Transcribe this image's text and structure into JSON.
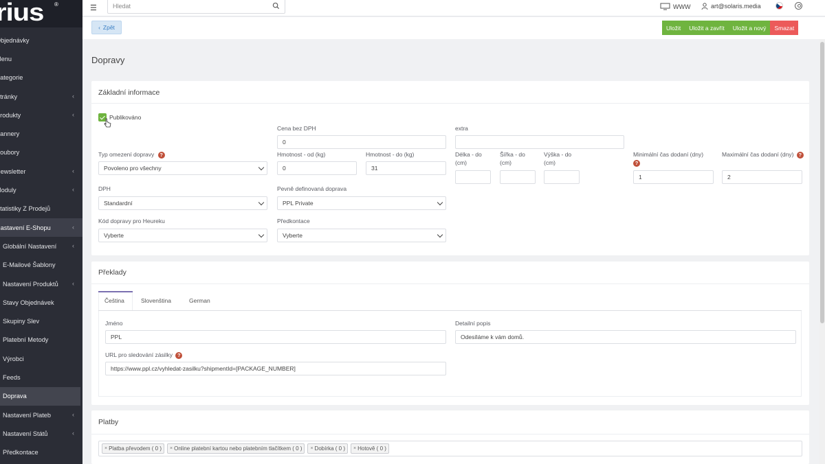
{
  "brand": {
    "logo_text": "rius",
    "reg": "®"
  },
  "sidebar": {
    "items": [
      {
        "label": "Objednávky",
        "chevron": false
      },
      {
        "label": "Menu",
        "chevron": false
      },
      {
        "label": "Kategorie",
        "chevron": false
      },
      {
        "label": "Stránky",
        "chevron": true
      },
      {
        "label": "Produkty",
        "chevron": true
      },
      {
        "label": "Bannery",
        "chevron": false
      },
      {
        "label": "Soubory",
        "chevron": false
      },
      {
        "label": "Newsletter",
        "chevron": true
      },
      {
        "label": "Moduly",
        "chevron": true
      },
      {
        "label": "Statistiky Z Prodejů",
        "chevron": false
      },
      {
        "label": "Nastavení E-Shopu",
        "chevron": true,
        "state": "open"
      },
      {
        "label": "Globální Nastavení",
        "chevron": true,
        "sub": true
      },
      {
        "label": "E-Mailové Šablony",
        "chevron": false,
        "sub": true
      },
      {
        "label": "Nastavení Produktů",
        "chevron": true,
        "sub": true
      },
      {
        "label": "Stavy Objednávek",
        "chevron": false,
        "sub": true
      },
      {
        "label": "Skupiny Slev",
        "chevron": false,
        "sub": true
      },
      {
        "label": "Platební Metody",
        "chevron": false,
        "sub": true
      },
      {
        "label": "Výrobci",
        "chevron": false,
        "sub": true
      },
      {
        "label": "Feeds",
        "chevron": false,
        "sub": true
      },
      {
        "label": "Doprava",
        "chevron": false,
        "sub": true,
        "state": "active"
      },
      {
        "label": "Nastavení Plateb",
        "chevron": true,
        "sub": true
      },
      {
        "label": "Nastavení Států",
        "chevron": true,
        "sub": true
      },
      {
        "label": "Předkontace",
        "chevron": false,
        "sub": true
      }
    ]
  },
  "topbar": {
    "search_placeholder": "Hledat",
    "www_label": "WWW",
    "user_email": "art@solaris.media"
  },
  "actions": {
    "back_label": "Zpět",
    "save_label": "Uložit",
    "save_close_label": "Uložit a zavřít",
    "save_new_label": "Uložit a nový",
    "delete_label": "Smazat"
  },
  "page": {
    "title": "Dopravy"
  },
  "basic": {
    "heading": "Základní informace",
    "published_label": "Publikováno",
    "published_checked": true,
    "price_label": "Cena bez DPH",
    "price_value": "0",
    "extra_label": "extra",
    "extra_value": "",
    "limit_type_label": "Typ omezení dopravy",
    "limit_type_value": "Povoleno pro všechny",
    "weight_from_label": "Hmotnost - od (kg)",
    "weight_from_value": "0",
    "weight_to_label": "Hmotnost - do (kg)",
    "weight_to_value": "31",
    "length_label": "Délka - do (cm)",
    "width_label": "Šířka - do (cm)",
    "height_label": "Výška - do (cm)",
    "min_days_label": "Minimální čas dodaní (dny)",
    "min_days_value": "1",
    "max_days_label": "Maximální čas dodaní (dny)",
    "max_days_value": "2",
    "vat_label": "DPH",
    "vat_value": "Standardní",
    "fixed_transport_label": "Pevně definovaná doprava",
    "fixed_transport_value": "PPL Private",
    "heureka_label": "Kód dopravy pro Heureku",
    "heureka_value": "Vyberte",
    "precontation_label": "Předkontace",
    "precontation_value": "Vyberte"
  },
  "translations": {
    "heading": "Překlady",
    "tabs": [
      "Čeština",
      "Slovenština",
      "German"
    ],
    "active_tab": "Čeština",
    "name_label": "Jméno",
    "name_value": "PPL",
    "detail_label": "Detailní popis",
    "detail_value": "Odesíláme k vám domů.",
    "url_label": "URL pro sledování zásilky",
    "url_value": "https://www.ppl.cz/vyhledat-zasilku?shipmentId=[PACKAGE_NUMBER]"
  },
  "payments": {
    "heading": "Platby",
    "chips": [
      "Platba převodem ( 0 )",
      "Online platební kartou nebo platebním tlačítkem ( 0 )",
      "Dobírka ( 0 )",
      "Hotově ( 0 )"
    ]
  },
  "colors": {
    "accent_green": "#6fb43f",
    "danger_red": "#ec5a5a",
    "sidebar_bg": "#2b2d36",
    "help_icon": "#c0503a"
  }
}
